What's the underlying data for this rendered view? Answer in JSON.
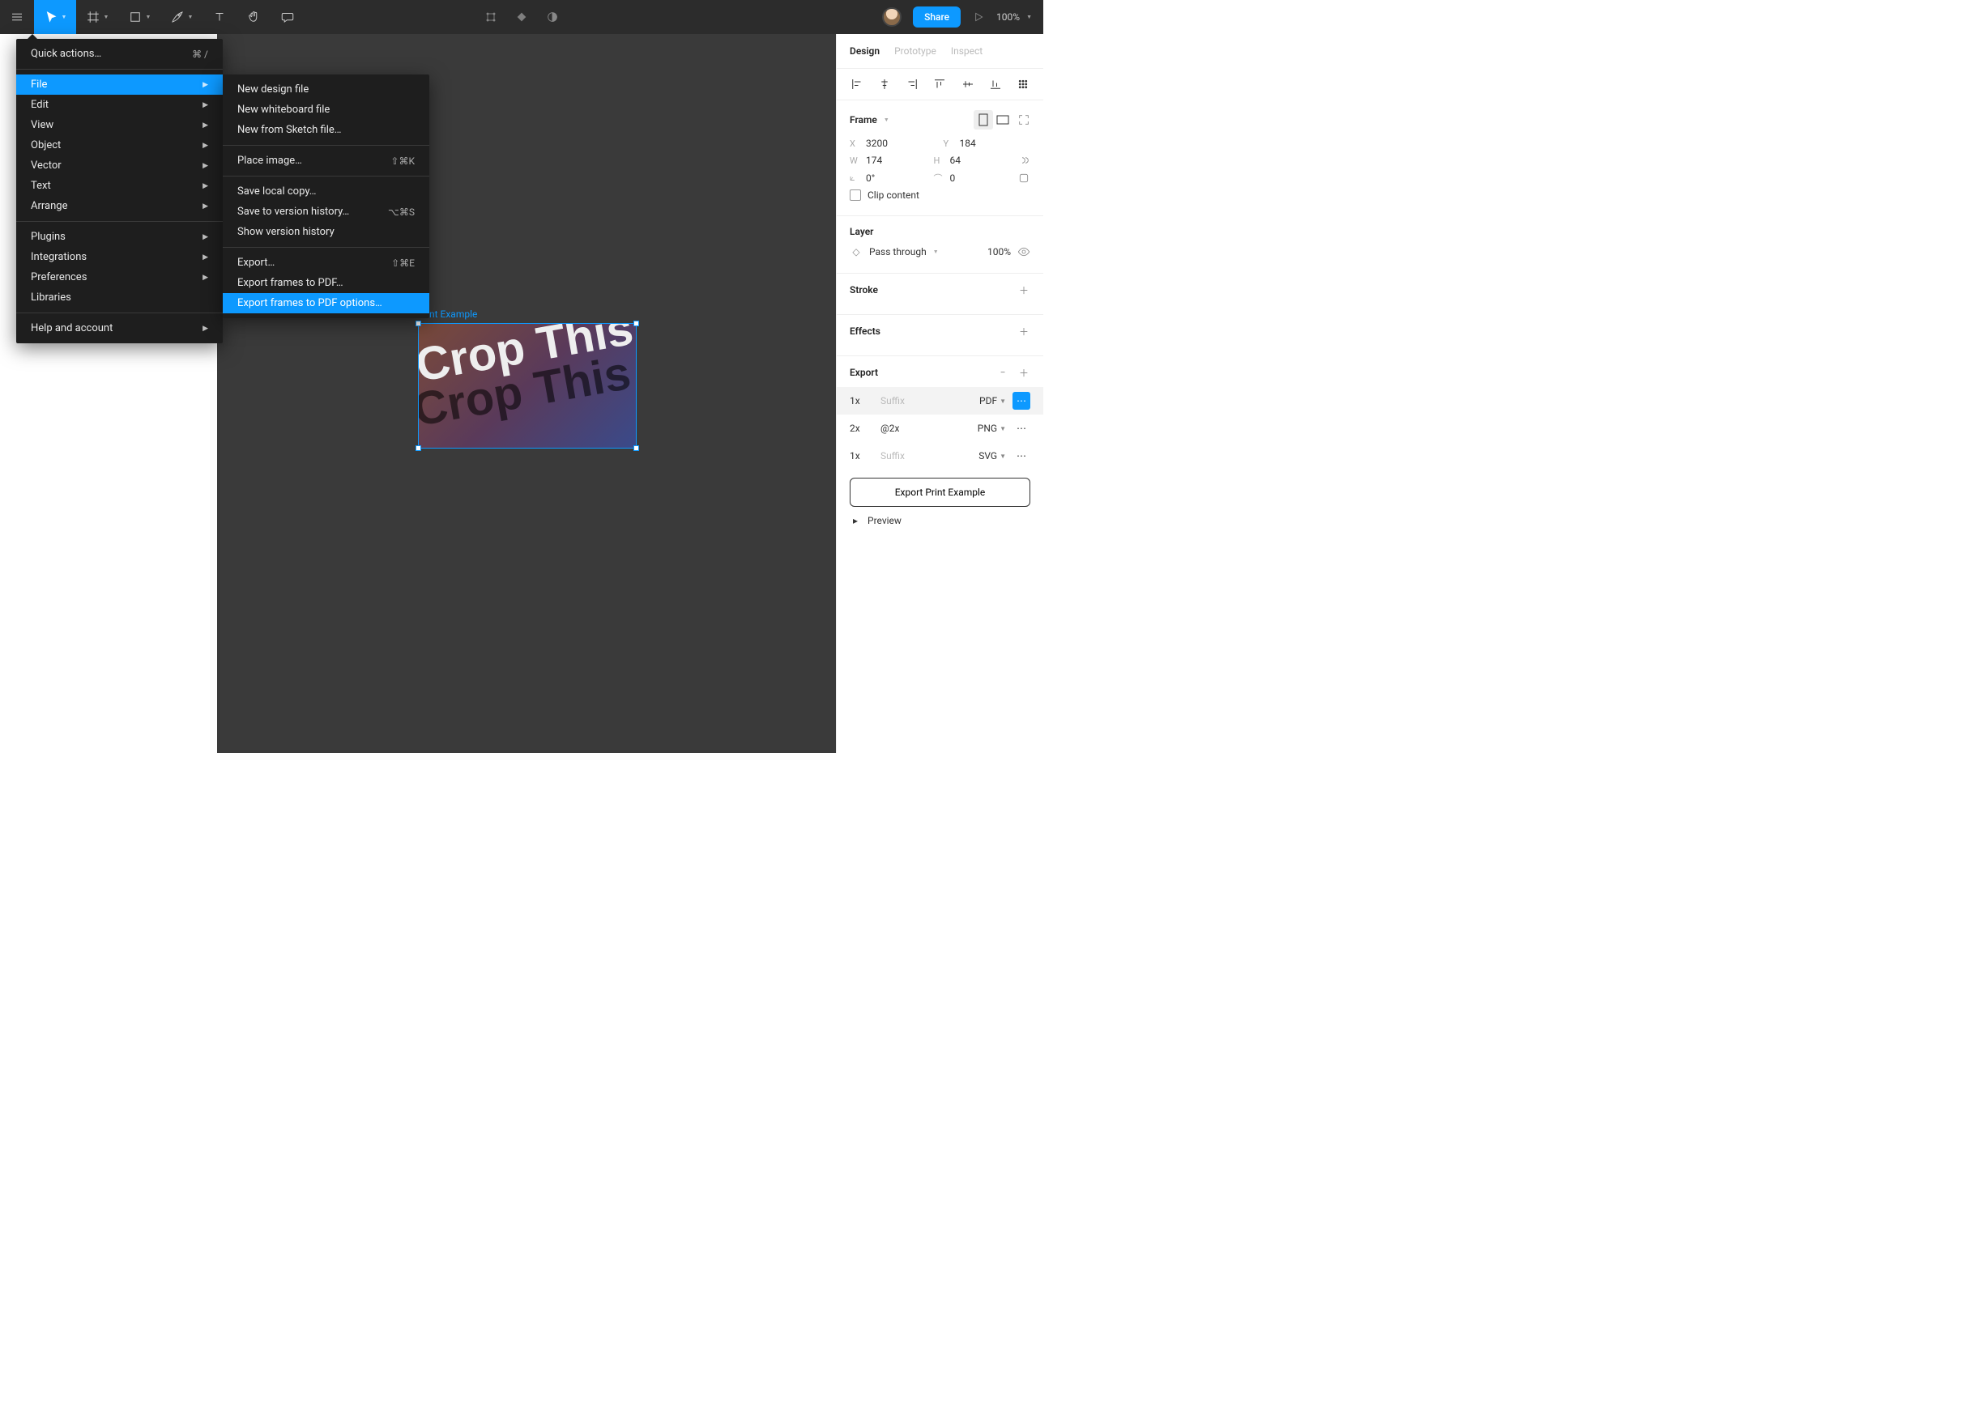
{
  "toolbar": {
    "share_label": "Share",
    "zoom": "100%"
  },
  "main_menu": {
    "quick_actions": "Quick actions…",
    "quick_actions_kbd": "⌘ /",
    "file": "File",
    "edit": "Edit",
    "view": "View",
    "object": "Object",
    "vector": "Vector",
    "text": "Text",
    "arrange": "Arrange",
    "plugins": "Plugins",
    "integrations": "Integrations",
    "preferences": "Preferences",
    "libraries": "Libraries",
    "help": "Help and account"
  },
  "file_menu": {
    "new_design": "New design file",
    "new_whiteboard": "New whiteboard file",
    "new_from_sketch": "New from Sketch file…",
    "place_image": "Place image…",
    "place_image_kbd": "⇧⌘K",
    "save_local": "Save local copy…",
    "save_version": "Save to version history…",
    "save_version_kbd": "⌥⌘S",
    "show_version": "Show version history",
    "export": "Export…",
    "export_kbd": "⇧⌘E",
    "export_frames_pdf": "Export frames to PDF…",
    "export_frames_pdf_options": "Export frames to PDF options…"
  },
  "canvas": {
    "frame_label": "nt Example",
    "text1": "Crop This",
    "text2": "Crop This"
  },
  "inspector": {
    "tabs": {
      "design": "Design",
      "prototype": "Prototype",
      "inspect": "Inspect"
    },
    "frame_label": "Frame",
    "x": "3200",
    "y": "184",
    "w": "174",
    "h": "64",
    "rotation": "0°",
    "corner": "0",
    "clip": "Clip content",
    "layer_label": "Layer",
    "blend": "Pass through",
    "opacity": "100%",
    "stroke_label": "Stroke",
    "effects_label": "Effects",
    "export_label": "Export",
    "exports": [
      {
        "scale": "1x",
        "suffix": "Suffix",
        "format": "PDF",
        "suffix_muted": true,
        "hl": true
      },
      {
        "scale": "2x",
        "suffix": "@2x",
        "format": "PNG",
        "suffix_muted": false,
        "hl": false
      },
      {
        "scale": "1x",
        "suffix": "Suffix",
        "format": "SVG",
        "suffix_muted": true,
        "hl": false
      }
    ],
    "export_button": "Export Print Example",
    "preview": "Preview"
  }
}
